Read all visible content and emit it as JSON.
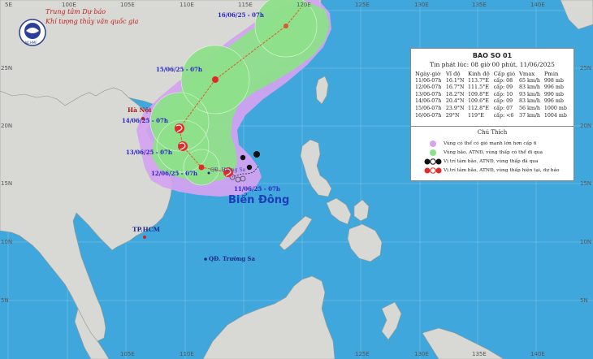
{
  "header": {
    "org_line1": "Trung tâm Dự báo",
    "org_line2": "Khí tượng thủy văn quốc gia",
    "logo_text": "NCHMF"
  },
  "bulletin": {
    "title": "BAO SO 01",
    "issued": "Tin phát lúc: 08 giờ 00 phút, 11/06/2025",
    "columns": [
      "Ngày-giờ",
      "Vĩ độ",
      "Kinh độ",
      "Cấp gió",
      "Vmax",
      "Pmin"
    ],
    "rows": [
      [
        "11/06-07h",
        "16.1°N",
        "113.7°E",
        "cấp: 08",
        "65 km/h",
        "998 mb"
      ],
      [
        "12/06-07h",
        "16.7°N",
        "111.5°E",
        "cấp: 09",
        "83 km/h",
        "996 mb"
      ],
      [
        "13/06-07h",
        "18.2°N",
        "109.8°E",
        "cấp: 10",
        "93 km/h",
        "990 mb"
      ],
      [
        "14/06-07h",
        "20.4°N",
        "109.6°E",
        "cấp: 09",
        "83 km/h",
        "996 mb"
      ],
      [
        "15/06-07h",
        "23.9°N",
        "112.8°E",
        "cấp: 07",
        "56 km/h",
        "1000 mb"
      ],
      [
        "16/06-07h",
        "29°N",
        "119°E",
        "cấp: <6",
        "37 km/h",
        "1004 mb"
      ]
    ]
  },
  "legend": {
    "title": "Chú Thích",
    "items": [
      {
        "text": "Vùng có thể có gió mạnh lớn hơn cấp 6",
        "color": "#d5a3f0"
      },
      {
        "text": "Vùng bão, ATNĐ, vùng thấp có thể đi qua",
        "color": "#8ee08a"
      },
      {
        "text": "Vị trí tâm bão, ATNĐ, vùng thấp đã qua",
        "color": "#111111"
      },
      {
        "text": "Vị trí tâm bão, ATNĐ, vùng thấp hiện tại, dự báo",
        "color": "#e32a2a"
      }
    ]
  },
  "map_labels": {
    "sea": "Biển Đông",
    "hanoi": "Hà Nội",
    "hcm": "TP.HCM",
    "paracel": "QĐ. Hoàng Sa",
    "spratly": "QĐ. Trường Sa",
    "dates": [
      "16/06/25 - 07h",
      "15/06/25 - 07h",
      "14/06/25 - 07h",
      "13/06/25 - 07h",
      "12/06/25 - 07h",
      "11/06/25 - 07h"
    ]
  },
  "grid": {
    "lon_labels": [
      "100E",
      "105E",
      "110E",
      "115E",
      "120E",
      "125E",
      "130E",
      "135E",
      "140E"
    ],
    "lat_labels": [
      "25N",
      "20N",
      "15N",
      "10N",
      "5N"
    ],
    "lat_labels_right": [
      "25N",
      "20N",
      "15N",
      "10N",
      "5N"
    ],
    "corner_label": "5E"
  },
  "colors": {
    "sea": "#3fa7dc",
    "land": "#d8d8d4",
    "danger_zone": "#d5a3f0",
    "track_cone": "#8ee08a",
    "track_line": "#e3552a",
    "date_label": "#2a23c9",
    "sea_label": "#1c3fb8"
  }
}
